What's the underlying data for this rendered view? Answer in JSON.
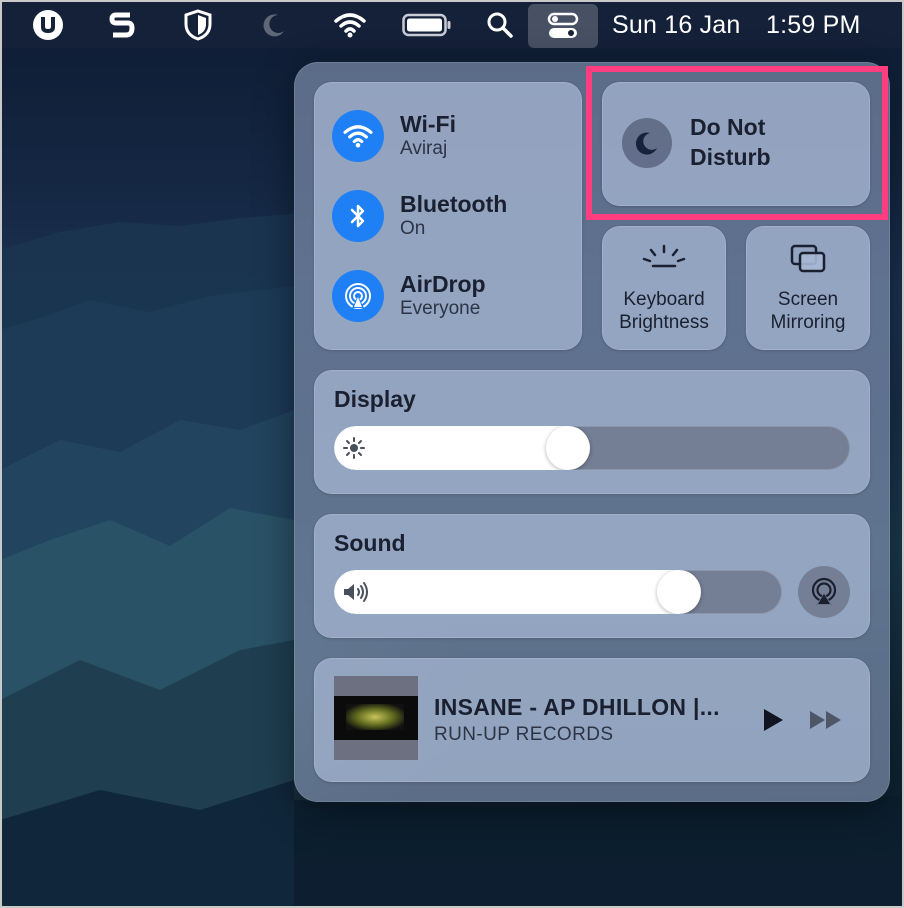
{
  "menubar": {
    "icons": [
      "utorrent-icon",
      "s-app-icon",
      "shield-icon",
      "moon-icon",
      "wifi-icon",
      "battery-icon",
      "search-icon",
      "control-center-icon"
    ],
    "date": "Sun 16 Jan",
    "time": "1:59 PM"
  },
  "control_center": {
    "network": [
      {
        "title": "Wi-Fi",
        "subtitle": "Aviraj",
        "icon": "wifi-icon"
      },
      {
        "title": "Bluetooth",
        "subtitle": "On",
        "icon": "bluetooth-icon"
      },
      {
        "title": "AirDrop",
        "subtitle": "Everyone",
        "icon": "airdrop-icon"
      }
    ],
    "do_not_disturb": {
      "line1": "Do Not",
      "line2": "Disturb",
      "icon": "moon-icon"
    },
    "keyboard_brightness": {
      "line1": "Keyboard",
      "line2": "Brightness",
      "icon": "keyboard-brightness-icon"
    },
    "screen_mirroring": {
      "line1": "Screen",
      "line2": "Mirroring",
      "icon": "screen-mirroring-icon"
    },
    "display": {
      "title": "Display",
      "level": 0.45,
      "icon": "sun-icon"
    },
    "sound": {
      "title": "Sound",
      "level": 0.8,
      "icon": "speaker-icon"
    },
    "now_playing": {
      "title": "INSANE - AP DHILLON |...",
      "artist": "RUN-UP RECORDS"
    }
  },
  "colors": {
    "accent": "#1f7ff5",
    "highlight": "#ff3d7f"
  }
}
